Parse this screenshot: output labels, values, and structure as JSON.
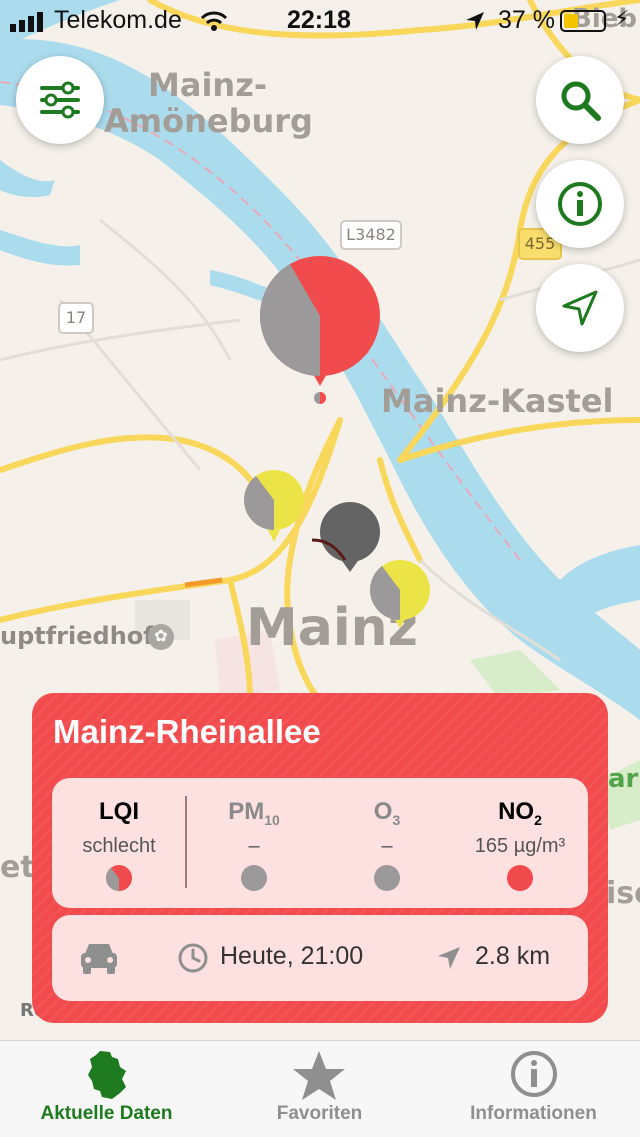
{
  "status_bar": {
    "carrier": "Telekom.de",
    "time": "22:18",
    "battery": "37 %"
  },
  "map": {
    "labels": [
      "Mainz-",
      "Amöneburg",
      "Mainz-Kastel",
      "Mainz",
      "uptfriedhof",
      "Bieb",
      "ark",
      "et",
      "ise",
      "Rö"
    ],
    "road_shields": [
      "L3482",
      "17",
      "455"
    ],
    "colors": {
      "water": "#abdcee",
      "road": "#f8d75a",
      "land": "#f5f1ea"
    }
  },
  "buttons": {
    "filter": "sliders-icon",
    "search": "search-icon",
    "info": "info-icon",
    "locate": "navigation-arrow-icon"
  },
  "station": {
    "name": "Mainz-Rheinallee",
    "columns": [
      {
        "label": "LQI",
        "sub": "",
        "value": "schlecht",
        "color": "#f24b4d"
      },
      {
        "label": "PM",
        "sub": "10",
        "value": "–",
        "color": "#9b9999"
      },
      {
        "label": "O",
        "sub": "3",
        "value": "–",
        "color": "#9b9999"
      },
      {
        "label": "NO",
        "sub": "2",
        "value": "165 µg/m³",
        "color": "#f24b4d"
      }
    ],
    "time": "Heute, 21:00",
    "distance": "2.8 km",
    "accent": "#f24b4d"
  },
  "tabs": [
    {
      "label": "Aktuelle Daten",
      "icon": "germany-map-icon",
      "active": true
    },
    {
      "label": "Favoriten",
      "icon": "star-icon",
      "active": false
    },
    {
      "label": "Informationen",
      "icon": "info-icon",
      "active": false
    }
  ]
}
